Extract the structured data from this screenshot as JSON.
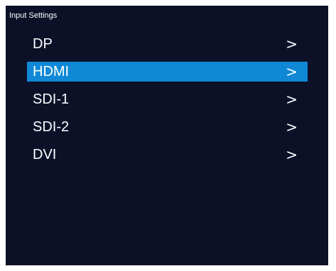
{
  "header": {
    "title": "Input Settings"
  },
  "menu": {
    "items": [
      {
        "label": "DP",
        "arrow": ">",
        "selected": false
      },
      {
        "label": "HDMI",
        "arrow": ">",
        "selected": true
      },
      {
        "label": "SDI-1",
        "arrow": ">",
        "selected": false
      },
      {
        "label": "SDI-2",
        "arrow": ">",
        "selected": false
      },
      {
        "label": "DVI",
        "arrow": ">",
        "selected": false
      }
    ]
  },
  "colors": {
    "background": "#0c1128",
    "selected": "#0f89d6",
    "text": "#ffffff"
  }
}
